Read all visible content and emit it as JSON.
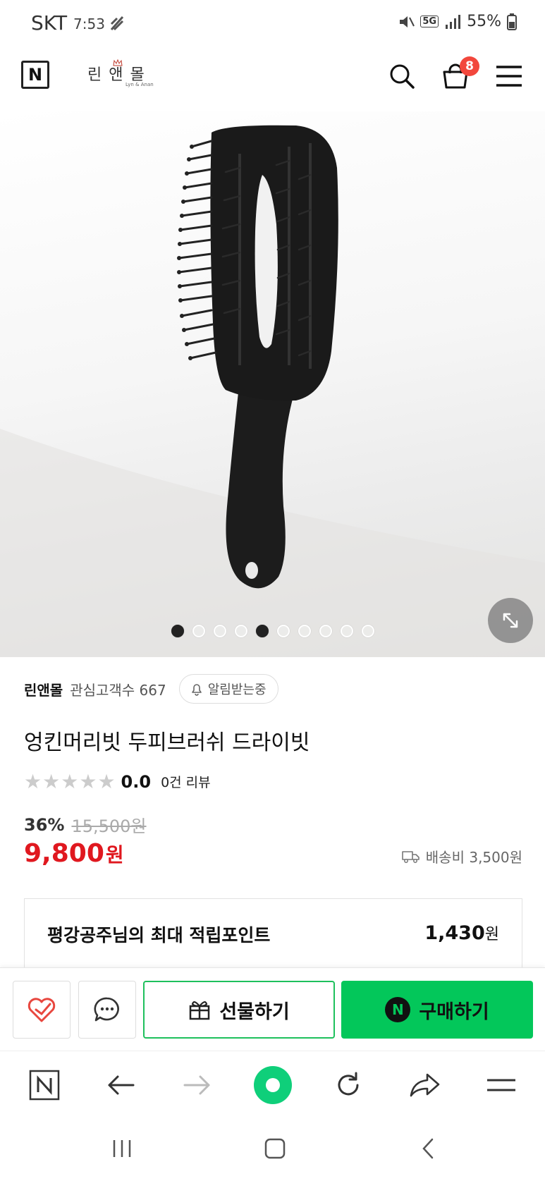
{
  "status_bar": {
    "carrier": "SKT",
    "time": "7:53",
    "network": "5G",
    "battery": "55%"
  },
  "header": {
    "logo_letter": "N",
    "store_logo_text": "린앤몰",
    "store_logo_sub": "Lyn & Anan",
    "cart_count": "8"
  },
  "gallery": {
    "image_count": 10,
    "active_index": 4
  },
  "product": {
    "store_name": "린앤몰",
    "fav_label": "관심고객수 667",
    "notify_label": "알림받는중",
    "title": "엉킨머리빗 두피브러쉬 드라이빗",
    "rating": "0.0",
    "stars_filled": 0,
    "review_count": "0건 리뷰",
    "discount_rate": "36%",
    "original_price": "15,500원",
    "price": "9,800",
    "price_unit": "원",
    "shipping": "배송비 3,500원"
  },
  "points": {
    "label": "평강공주님의 최대 적립포인트",
    "value": "1,430",
    "unit": "원"
  },
  "actions": {
    "gift_label": "선물하기",
    "buy_label": "구매하기",
    "buy_badge": "N"
  },
  "colors": {
    "price_red": "#e0181f",
    "naver_green": "#03c75a",
    "badge_red": "#f2473c"
  }
}
